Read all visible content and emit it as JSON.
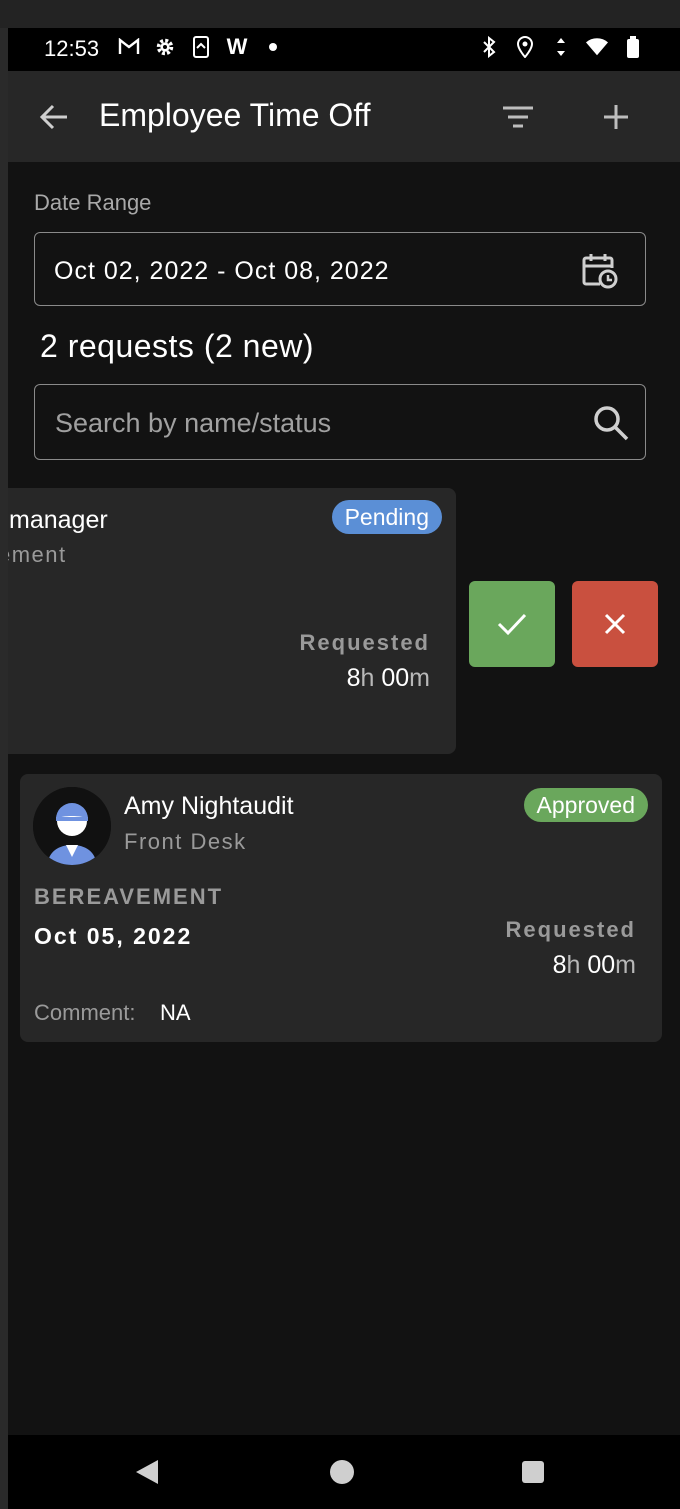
{
  "status_bar": {
    "time": "12:53",
    "left_icons": [
      "gmail-icon",
      "settings-icon",
      "screen-share-icon",
      "w-icon",
      "dot-icon"
    ],
    "w_label": "W",
    "right_icons": [
      "bluetooth-icon",
      "location-icon",
      "data-arrows-icon",
      "wifi-icon",
      "battery-icon"
    ]
  },
  "app_bar": {
    "title": "Employee Time Off",
    "icons": {
      "back": "arrow-left-icon",
      "filter": "filter-icon",
      "add": "plus-icon"
    }
  },
  "date_range": {
    "label": "Date Range",
    "value": "Oct 02, 2022 - Oct 08, 2022",
    "icon": "calendar-clock-icon"
  },
  "summary": {
    "requests_text": "2 requests (2 new)"
  },
  "search": {
    "placeholder": "Search by name/status",
    "value": "",
    "icon": "search-icon"
  },
  "requests": [
    {
      "name_visible": "manager",
      "department_visible": "ement",
      "status": "Pending",
      "requested_label": "Requested",
      "hours": "8",
      "hours_unit": "h",
      "minutes": "00",
      "minutes_unit": "m",
      "actions": {
        "approve_icon": "check-icon",
        "reject_icon": "close-icon"
      }
    },
    {
      "name": "Amy Nightaudit",
      "department": "Front Desk",
      "status": "Approved",
      "type": "BEREAVEMENT",
      "date": "Oct 05, 2022",
      "requested_label": "Requested",
      "hours": "8",
      "hours_unit": "h",
      "minutes": "00",
      "minutes_unit": "m",
      "comment_label": "Comment:",
      "comment": "NA",
      "avatar_icon": "user-avatar-icon"
    }
  ],
  "colors": {
    "background": "#121212",
    "card": "#272727",
    "pending": "#5b8fd6",
    "approved": "#6aa75c",
    "reject": "#c9503f"
  }
}
